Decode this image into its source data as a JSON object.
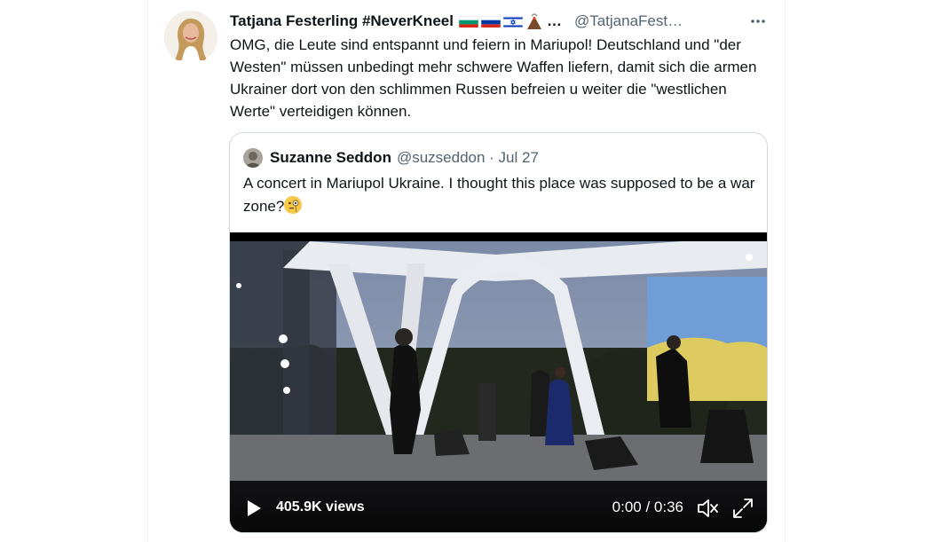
{
  "tweet": {
    "author_name": "Tatjana Festerling #NeverKneel",
    "name_overflow": "…",
    "handle": "@TatjanaFest…",
    "more_icon": "more-horizontal-icon",
    "text": "OMG, die Leute sind entspannt und feiern in Mariupol! Deutschland und \"der Westen\" müssen unbedingt mehr schwere Waffen liefern, damit sich die armen Ukrainer dort von den schlimmen Russen befreien u weiter die \"westlichen Werte\" verteidigen können."
  },
  "quote": {
    "author_name": "Suzanne Seddon",
    "meta": "@suzseddon · Jul 27",
    "text": "A concert in Mariupol Ukraine. I thought this place was supposed to be a war zone?",
    "emoji": "face-with-monocle-emoji"
  },
  "video": {
    "views": "405.9K views",
    "time": "0:00 / 0:36",
    "play_icon": "play-icon",
    "mute_icon": "volume-muted-icon",
    "expand_icon": "expand-icon"
  },
  "colors": {
    "text": "#0f1419",
    "secondary": "#536471",
    "border": "#cfd9de"
  }
}
